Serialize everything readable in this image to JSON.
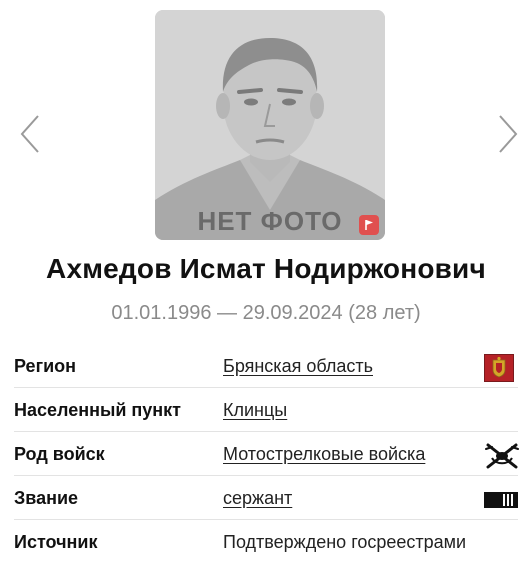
{
  "photo": {
    "placeholder_text": "НЕТ ФОТО",
    "report_icon": "flag-icon",
    "report_color": "#e0504f"
  },
  "navigation": {
    "prev_icon": "chevron-left-icon",
    "next_icon": "chevron-right-icon"
  },
  "person": {
    "name": "Ахмедов Исмат Нодиржонович",
    "dates": "01.01.1996 — 29.09.2024 (28 лет)"
  },
  "details": [
    {
      "label": "Регион",
      "value": "Брянская область",
      "link": true,
      "icon": "region-coat-of-arms-icon"
    },
    {
      "label": "Населенный пункт",
      "value": "Клинцы",
      "link": true,
      "icon": ""
    },
    {
      "label": "Род войск",
      "value": "Мотострелковые войска",
      "link": true,
      "icon": "motor-rifle-emblem-icon"
    },
    {
      "label": "Звание",
      "value": "сержант",
      "link": true,
      "icon": "sergeant-rank-icon"
    },
    {
      "label": "Источник",
      "value": "Подтверждено госреестрами",
      "link": false,
      "icon": ""
    }
  ],
  "colors": {
    "coat_of_arms_red": "#b52227",
    "coat_of_arms_gold": "#d4a628"
  }
}
